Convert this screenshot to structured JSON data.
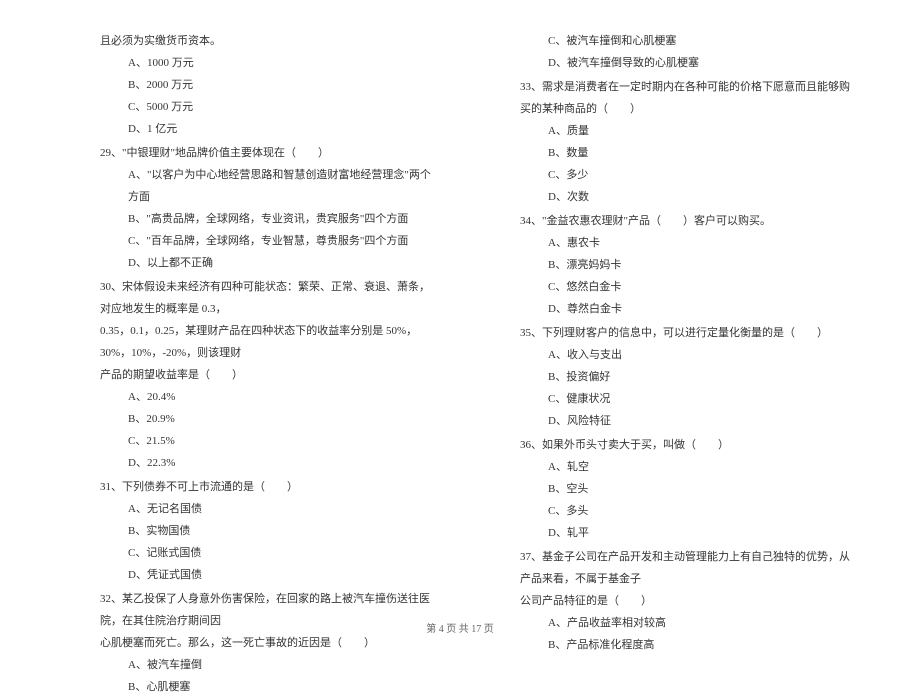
{
  "left_column": {
    "continuation_text": "且必须为实缴货币资本。",
    "continuation_options": [
      "A、1000 万元",
      "B、2000 万元",
      "C、5000 万元",
      "D、1 亿元"
    ],
    "q29": {
      "text": "29、\"中银理财\"地品牌价值主要体现在（　　）",
      "options": [
        "A、\"以客户为中心地经营思路和智慧创造财富地经营理念\"两个方面",
        "B、\"高贵品牌，全球网络，专业资讯，贵宾服务\"四个方面",
        "C、\"百年品牌，全球网络，专业智慧，尊贵服务\"四个方面",
        "D、以上都不正确"
      ]
    },
    "q30": {
      "text_line1": "30、宋体假设未来经济有四种可能状态：繁荣、正常、衰退、萧条，对应地发生的概率是 0.3，",
      "text_line2": "0.35，0.1，0.25，某理财产品在四种状态下的收益率分别是 50%，30%，10%，-20%，则该理财",
      "text_line3": "产品的期望收益率是（　　）",
      "options": [
        "A、20.4%",
        "B、20.9%",
        "C、21.5%",
        "D、22.3%"
      ]
    },
    "q31": {
      "text": "31、下列债券不可上市流通的是（　　）",
      "options": [
        "A、无记名国债",
        "B、实物国债",
        "C、记账式国债",
        "D、凭证式国债"
      ]
    },
    "q32": {
      "text_line1": "32、某乙投保了人身意外伤害保险，在回家的路上被汽车撞伤送往医院，在其住院治疗期间因",
      "text_line2": "心肌梗塞而死亡。那么，这一死亡事故的近因是（　　）",
      "options": [
        "A、被汽车撞倒",
        "B、心肌梗塞"
      ]
    }
  },
  "right_column": {
    "q32_continued_options": [
      "C、被汽车撞倒和心肌梗塞",
      "D、被汽车撞倒导致的心肌梗塞"
    ],
    "q33": {
      "text": "33、需求是消费者在一定时期内在各种可能的价格下愿意而且能够购买的某种商品的（　　）",
      "options": [
        "A、质量",
        "B、数量",
        "C、多少",
        "D、次数"
      ]
    },
    "q34": {
      "text": "34、\"金益农惠农理财\"产品（　　）客户可以购买。",
      "options": [
        "A、惠农卡",
        "B、漂亮妈妈卡",
        "C、悠然白金卡",
        "D、尊然白金卡"
      ]
    },
    "q35": {
      "text": "35、下列理财客户的信息中，可以进行定量化衡量的是（　　）",
      "options": [
        "A、收入与支出",
        "B、投资偏好",
        "C、健康状况",
        "D、风险特征"
      ]
    },
    "q36": {
      "text": "36、如果外币头寸卖大于买，叫做（　　）",
      "options": [
        "A、轧空",
        "B、空头",
        "C、多头",
        "D、轧平"
      ]
    },
    "q37": {
      "text_line1": "37、基金子公司在产品开发和主动管理能力上有自己独特的优势，从产品来看，不属于基金子",
      "text_line2": "公司产品特征的是（　　）",
      "options": [
        "A、产品收益率相对较高",
        "B、产品标准化程度高"
      ]
    }
  },
  "footer": "第 4 页 共 17 页"
}
